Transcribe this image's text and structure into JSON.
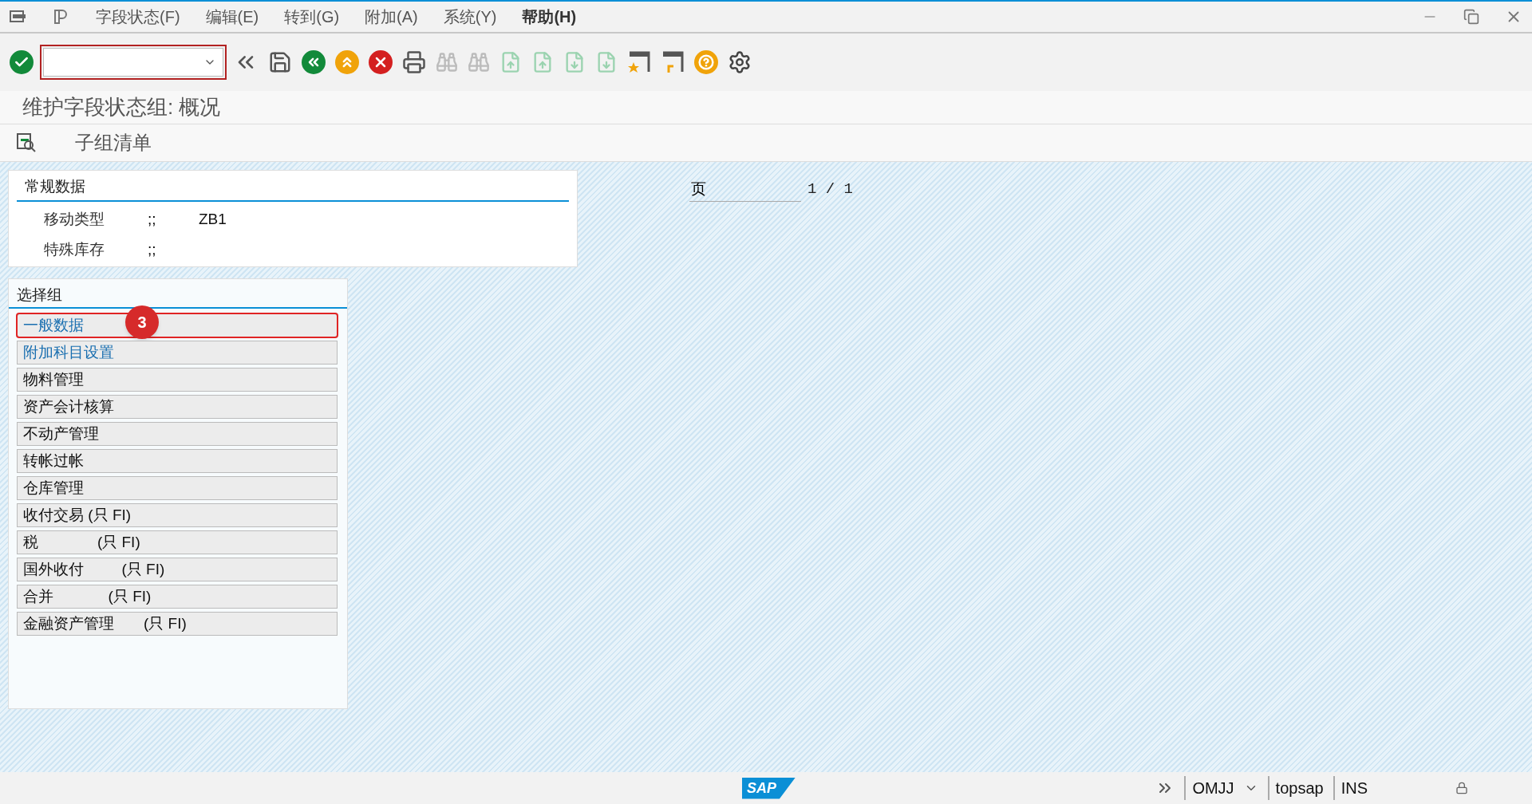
{
  "menu_bar": {
    "items": [
      {
        "label": "字段状态(F)",
        "bold": false
      },
      {
        "label": "编辑(E)",
        "bold": false
      },
      {
        "label": "转到(G)",
        "bold": false
      },
      {
        "label": "附加(A)",
        "bold": false
      },
      {
        "label": "系统(Y)",
        "bold": false
      },
      {
        "label": "帮助(H)",
        "bold": true
      }
    ]
  },
  "screen_title": "维护字段状态组: 概况",
  "app_toolbar": {
    "button": "子组清单"
  },
  "general_data": {
    "title": "常规数据",
    "fields": [
      {
        "label": "移动类型",
        "separator": ";;",
        "value": "ZB1"
      },
      {
        "label": "特殊库存",
        "separator": ";;"
      }
    ]
  },
  "page_indicator": {
    "label": "页",
    "value": "1 / 1"
  },
  "select_group": {
    "title": "选择组",
    "items": [
      {
        "label": "一般数据",
        "active": true,
        "annotated": true
      },
      {
        "label": "附加科目设置",
        "active": true,
        "annotated": false
      },
      {
        "label": "物料管理",
        "active": false,
        "annotated": false
      },
      {
        "label": "资产会计核算",
        "active": false,
        "annotated": false
      },
      {
        "label": "不动产管理",
        "active": false,
        "annotated": false
      },
      {
        "label": "转帐过帐",
        "active": false,
        "annotated": false
      },
      {
        "label": "仓库管理",
        "active": false,
        "annotated": false
      },
      {
        "label": "收付交易 (只 FI)",
        "active": false,
        "annotated": false
      },
      {
        "label": "税              (只 FI)",
        "active": false,
        "annotated": false
      },
      {
        "label": "国外收付         (只 FI)",
        "active": false,
        "annotated": false
      },
      {
        "label": "合并             (只 FI)",
        "active": false,
        "annotated": false
      },
      {
        "label": "金融资产管理       (只 FI)",
        "active": false,
        "annotated": false
      }
    ],
    "annotation": "3"
  },
  "status_bar": {
    "logo": "SAP",
    "transaction": "OMJJ",
    "user": "topsap",
    "mode": "INS"
  }
}
